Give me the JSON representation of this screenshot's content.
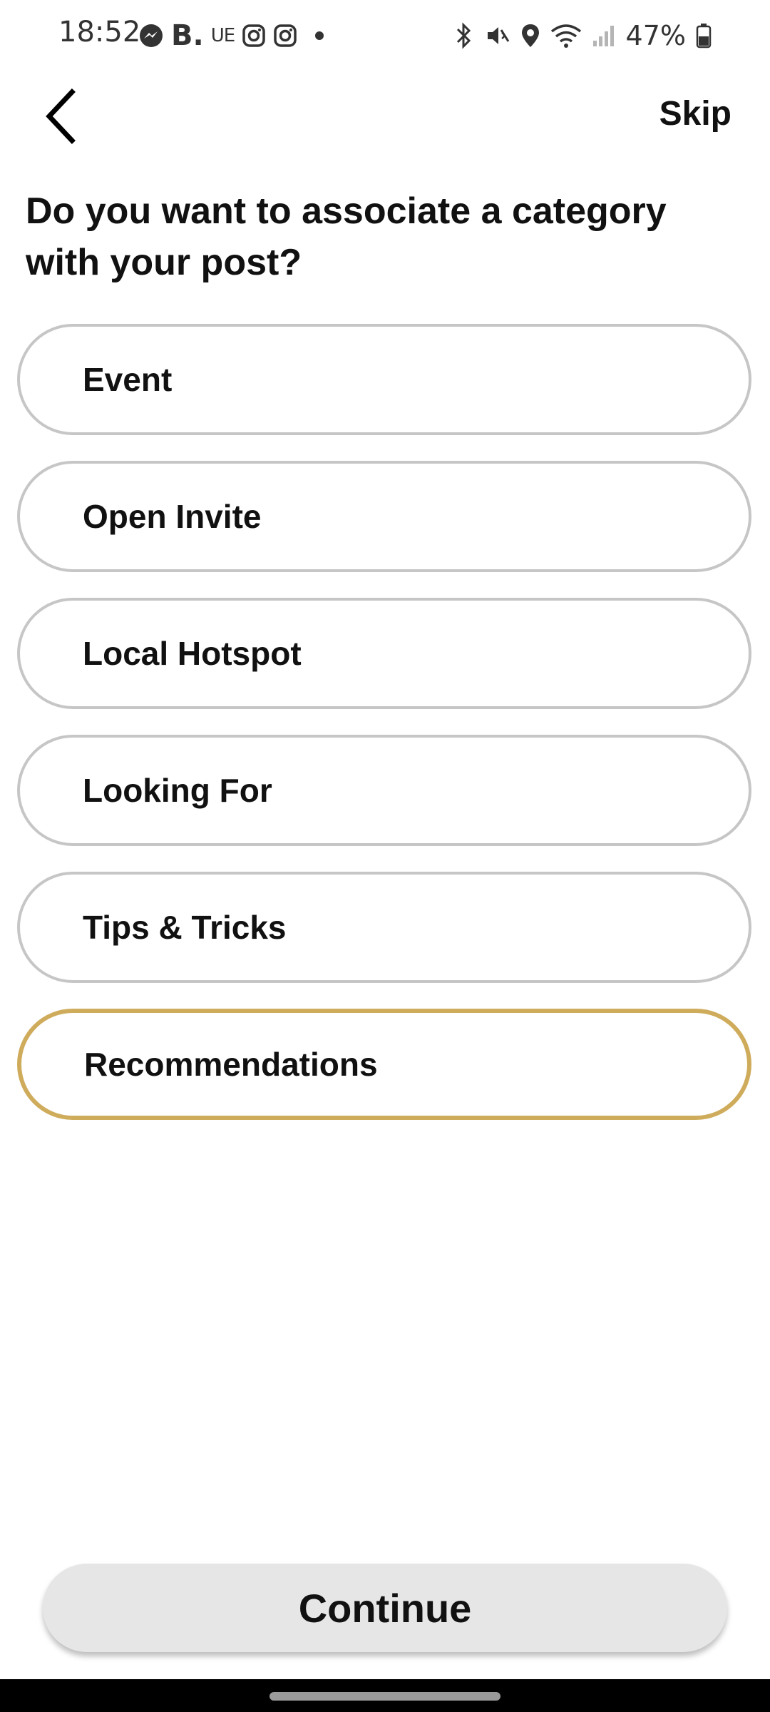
{
  "status_bar": {
    "time": "18:52",
    "battery_percent": "47%",
    "booking_letter": "B.",
    "ue_letters": "UE",
    "left_icons": [
      "messenger-icon",
      "booking-icon",
      "ue-icon",
      "instagram-icon",
      "instagram-icon",
      "dot-icon"
    ],
    "right_icons": [
      "bluetooth-icon",
      "mute-icon",
      "location-icon",
      "wifi-icon",
      "signal-icon",
      "battery-icon"
    ]
  },
  "header": {
    "back_icon": "chevron-left-icon",
    "skip_label": "Skip"
  },
  "question": "Do you want to associate a category with your post?",
  "options": [
    {
      "label": "Event",
      "selected": false
    },
    {
      "label": "Open Invite",
      "selected": false
    },
    {
      "label": "Local Hotspot",
      "selected": false
    },
    {
      "label": "Looking For",
      "selected": false
    },
    {
      "label": "Tips & Tricks",
      "selected": false
    },
    {
      "label": "Recommendations",
      "selected": true
    }
  ],
  "continue_label": "Continue",
  "colors": {
    "selected_border": "#cfac5c",
    "unselected_border": "#c6c6c6",
    "continue_bg": "#e6e6e6"
  }
}
